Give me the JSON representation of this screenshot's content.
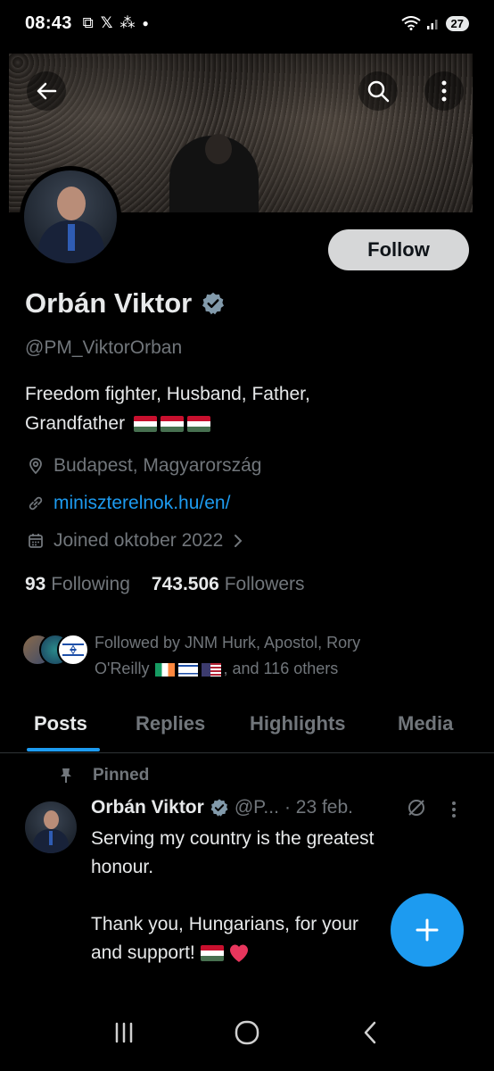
{
  "status_bar": {
    "time": "08:43",
    "battery": "27"
  },
  "profile": {
    "name": "Orbán Viktor",
    "handle": "@PM_ViktorOrban",
    "bio_line1": "Freedom fighter, Husband, Father,",
    "bio_line2": "Grandfather",
    "location": "Budapest, Magyarország",
    "website": "miniszterelnok.hu/en/",
    "joined": "Joined oktober 2022",
    "following_count": "93",
    "following_label": "Following",
    "followers_count": "743.506",
    "followers_label": "Followers",
    "follow_button": "Follow",
    "followed_by_line1": "Followed by JNM Hurk, Apostol, Rory",
    "followed_by_line2_prefix": "O'Reilly",
    "followed_by_line2_suffix": ", and 116 others"
  },
  "tabs": [
    "Posts",
    "Replies",
    "Highlights",
    "Media"
  ],
  "pinned_tweet": {
    "pinned_label": "Pinned",
    "author": "Orbán Viktor",
    "handle_truncated": "@P...",
    "date": "· 23 feb.",
    "text_line1": "Serving my country is the greatest",
    "text_line2": "honour.",
    "text_line3": "Thank you, Hungarians, for your",
    "text_line4": "and support!"
  },
  "icons": {
    "back": "arrow-left-icon",
    "search": "search-icon",
    "more": "more-vertical-icon",
    "location": "location-pin-icon",
    "link": "link-icon",
    "calendar": "calendar-icon",
    "pin": "pin-icon",
    "compose": "plus-icon"
  },
  "colors": {
    "accent": "#1d9bf0",
    "background": "#000000",
    "text_primary": "#e7e9ea",
    "text_secondary": "#71767b",
    "follow_button_bg": "#d6d7d8"
  }
}
